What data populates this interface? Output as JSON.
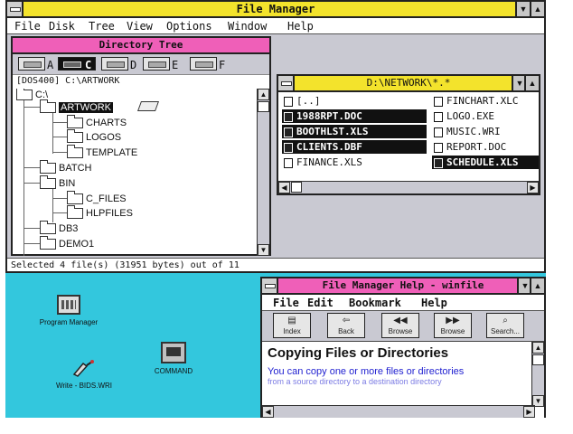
{
  "file_manager": {
    "title": "File Manager",
    "menu": [
      "File",
      "Disk",
      "Tree",
      "View",
      "Options",
      "Window",
      "Help"
    ],
    "status": "Selected 4 file(s) (31951 bytes) out of 11"
  },
  "directory_tree": {
    "title": "Directory Tree",
    "drives": [
      "A",
      "C",
      "D",
      "E",
      "F"
    ],
    "selected_drive": "C",
    "volume_path": "[DOS400]  C:\\ARTWORK",
    "root": "C:\\",
    "nodes": [
      {
        "label": "ARTWORK",
        "selected": true
      },
      {
        "label": "CHARTS"
      },
      {
        "label": "LOGOS"
      },
      {
        "label": "TEMPLATE"
      },
      {
        "label": "BATCH"
      },
      {
        "label": "BIN"
      },
      {
        "label": "C_FILES"
      },
      {
        "label": "HLPFILES"
      },
      {
        "label": "DB3"
      },
      {
        "label": "DEMO1"
      }
    ]
  },
  "network_window": {
    "title": "D:\\NETWORK\\*.*",
    "files_left": [
      {
        "name": "[..]",
        "selected": false,
        "icon": "up-folder-icon"
      },
      {
        "name": "1988RPT.DOC",
        "selected": true
      },
      {
        "name": "BOOTHLST.XLS",
        "selected": true
      },
      {
        "name": "CLIENTS.DBF",
        "selected": true
      },
      {
        "name": "FINANCE.XLS",
        "selected": false
      }
    ],
    "files_right": [
      {
        "name": "FINCHART.XLC",
        "selected": false
      },
      {
        "name": "LOGO.EXE",
        "selected": false
      },
      {
        "name": "MUSIC.WRI",
        "selected": false
      },
      {
        "name": "REPORT.DOC",
        "selected": false
      },
      {
        "name": "SCHEDULE.XLS",
        "selected": true
      }
    ]
  },
  "desktop": {
    "icons": [
      {
        "label": "Program Manager",
        "icon": "program-manager-icon"
      },
      {
        "label": "COMMAND",
        "icon": "command-icon"
      },
      {
        "label": "Write - BIDS.WRI",
        "icon": "write-icon"
      }
    ]
  },
  "help_window": {
    "title": "File Manager Help - winfile",
    "menu": [
      "File",
      "Edit",
      "Bookmark",
      "Help"
    ],
    "buttons": [
      {
        "label": "Index",
        "glyph": "▤"
      },
      {
        "label": "Back",
        "glyph": "⇦"
      },
      {
        "label": "Browse",
        "glyph": "◀◀"
      },
      {
        "label": "Browse",
        "glyph": "▶▶"
      },
      {
        "label": "Search...",
        "glyph": "⌕"
      }
    ],
    "heading": "Copying Files or Directories",
    "body": "You can copy one or more files or directories",
    "body_faded": "from a source directory to a destination directory"
  }
}
